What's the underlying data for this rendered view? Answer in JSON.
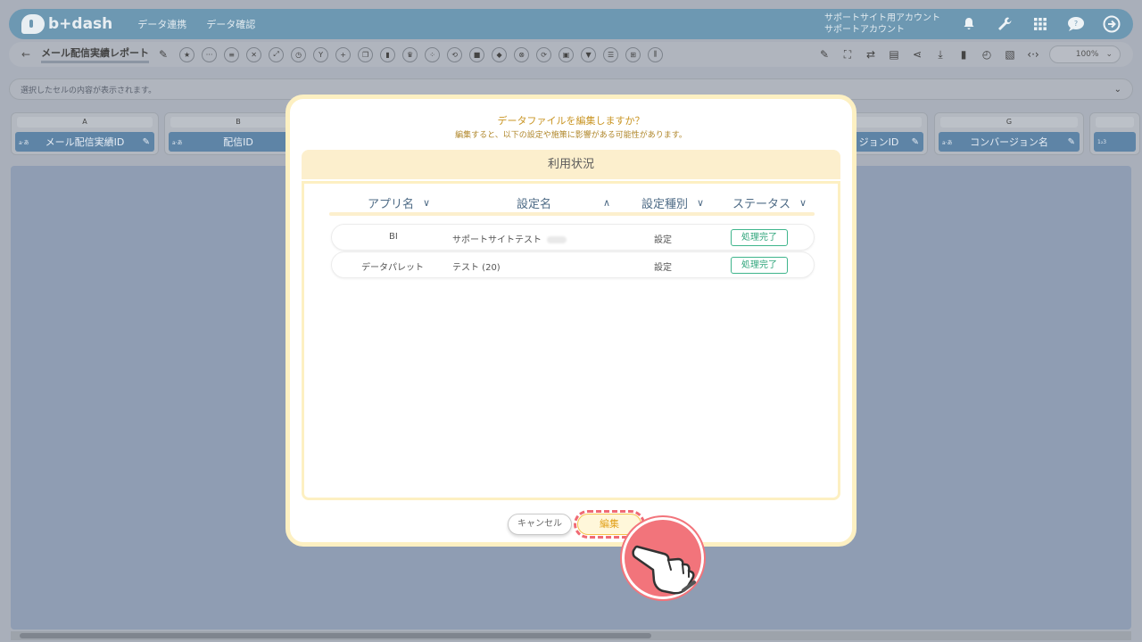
{
  "header": {
    "logo_text": "b+dash",
    "nav": [
      "データ連携",
      "データ確認"
    ],
    "account_line1": "サポートサイト用アカウント",
    "account_line2": "サポートアカウント"
  },
  "toolbar": {
    "back_symbol": "←",
    "report_title": "メール配信実績レポート",
    "zoom": "100%"
  },
  "cellbar": {
    "placeholder": "選択したセルの内容が表示されます。"
  },
  "columns": [
    {
      "letter": "A",
      "name": "メール配信実績ID",
      "type": "a·あ"
    },
    {
      "letter": "B",
      "name": "配信ID",
      "type": "a·あ"
    },
    {
      "letter": "",
      "name": "ジョンID",
      "type": ""
    },
    {
      "letter": "G",
      "name": "コンバージョン名",
      "type": "a·あ"
    },
    {
      "letter": "",
      "name": "",
      "type": "1₂3"
    }
  ],
  "modal": {
    "title": "データファイルを編集しますか？",
    "subtitle": "編集すると、以下の設定や施策に影響がある可能性があります。",
    "panel_title": "利用状況",
    "headers": {
      "app": "アプリ名",
      "setting": "設定名",
      "type": "設定種別",
      "status": "ステータス"
    },
    "rows": [
      {
        "app": "BI",
        "setting": "サポートサイトテスト",
        "type": "設定",
        "status": "処理完了"
      },
      {
        "app": "データパレット",
        "setting": "テスト (20)",
        "type": "設定",
        "status": "処理完了"
      }
    ],
    "cancel_label": "キャンセル",
    "edit_label": "編集"
  },
  "colors": {
    "header_bg": "#6d98b2",
    "modal_border": "#fdf0c2",
    "status_green": "#2fa57b",
    "highlight_red": "#f06a74"
  }
}
